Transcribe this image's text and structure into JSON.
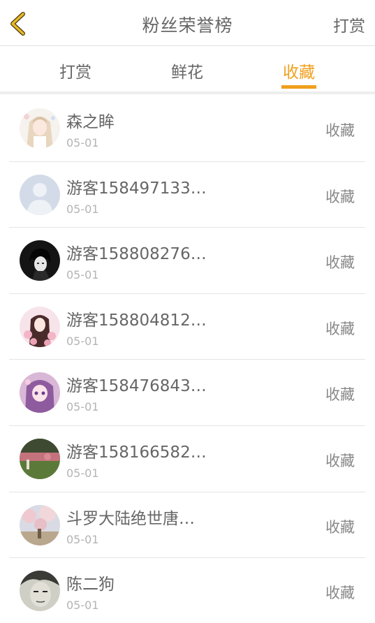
{
  "header": {
    "title": "粉丝荣誉榜",
    "right_link": "打赏",
    "accent_color": "#f0a01e"
  },
  "tabs": [
    {
      "label": "打赏",
      "active": false
    },
    {
      "label": "鲜花",
      "active": false
    },
    {
      "label": "收藏",
      "active": true
    }
  ],
  "fans": [
    {
      "name": "森之眸",
      "date": "05-01",
      "action": "收藏",
      "avatar_icon": "anime-girl-avatar"
    },
    {
      "name": "游客158497133…",
      "date": "05-01",
      "action": "收藏",
      "avatar_icon": "default-user-avatar"
    },
    {
      "name": "游客158808276…",
      "date": "05-01",
      "action": "收藏",
      "avatar_icon": "dark-anime-boy-avatar"
    },
    {
      "name": "游客158804812…",
      "date": "05-01",
      "action": "收藏",
      "avatar_icon": "anime-girl-pink-avatar"
    },
    {
      "name": "游客158476843…",
      "date": "05-01",
      "action": "收藏",
      "avatar_icon": "anime-girl-purple-avatar"
    },
    {
      "name": "游客158166582…",
      "date": "05-01",
      "action": "收藏",
      "avatar_icon": "garden-photo-avatar"
    },
    {
      "name": "斗罗大陆绝世唐…",
      "date": "05-01",
      "action": "收藏",
      "avatar_icon": "blossom-photo-avatar"
    },
    {
      "name": "陈二狗",
      "date": "05-01",
      "action": "收藏",
      "avatar_icon": "sketch-face-avatar"
    }
  ]
}
